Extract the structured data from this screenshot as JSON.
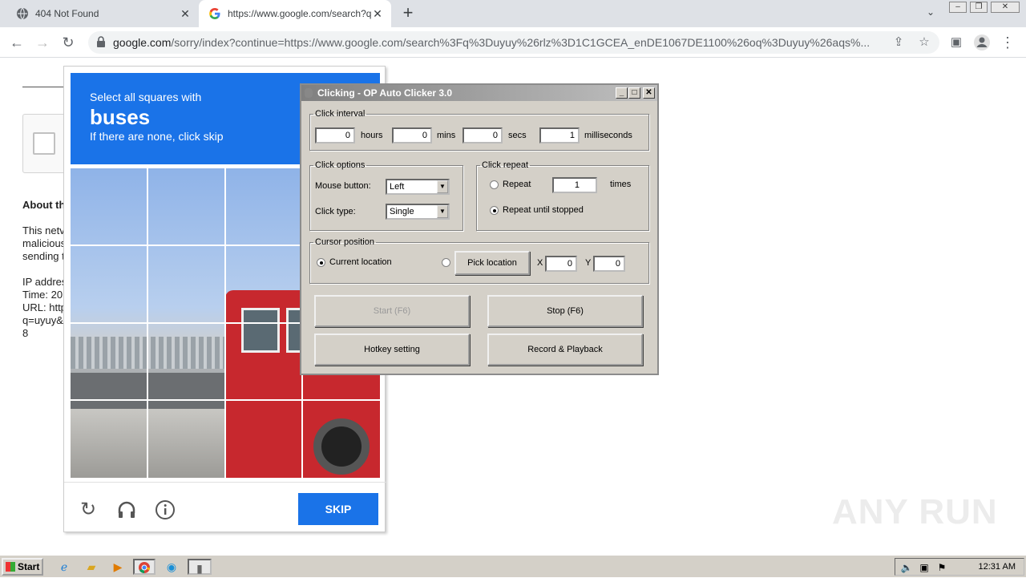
{
  "browser": {
    "tabs": [
      {
        "title": "404 Not Found",
        "icon": "globe-icon"
      },
      {
        "title": "https://www.google.com/search?q=",
        "icon": "google-icon"
      }
    ],
    "address_host": "google.com",
    "address_rest": "/sorry/index?continue=https://www.google.com/search%3Fq%3Duyuy%26rlz%3D1C1GCEA_enDE1067DE1100%26oq%3Duyuy%26aqs%..."
  },
  "page": {
    "about_heading": "About th",
    "lines": [
      "This netv",
      "malicious",
      "sending t"
    ],
    "info_lines": [
      "IP addres",
      "Time: 20",
      "URL: http",
      "q=uyuy&",
      "8"
    ]
  },
  "captcha": {
    "instruction_1": "Select all squares with",
    "target": "buses",
    "instruction_2": "If there are none, click skip",
    "skip_label": "SKIP"
  },
  "clicker": {
    "title": "Clicking - OP Auto Clicker 3.0",
    "interval_legend": "Click interval",
    "hours_value": "0",
    "hours_label": "hours",
    "mins_value": "0",
    "mins_label": "mins",
    "secs_value": "0",
    "secs_label": "secs",
    "ms_value": "1",
    "ms_label": "milliseconds",
    "options_legend": "Click options",
    "mouse_button_label": "Mouse button:",
    "mouse_button_value": "Left",
    "click_type_label": "Click type:",
    "click_type_value": "Single",
    "repeat_legend": "Click repeat",
    "repeat_label": "Repeat",
    "repeat_value": "1",
    "times_label": "times",
    "repeat_until_label": "Repeat until stopped",
    "cursor_legend": "Cursor position",
    "current_location_label": "Current location",
    "pick_location_label": "Pick location",
    "x_label": "X",
    "x_value": "0",
    "y_label": "Y",
    "y_value": "0",
    "start_label": "Start (F6)",
    "stop_label": "Stop (F6)",
    "hotkey_label": "Hotkey setting",
    "record_label": "Record & Playback"
  },
  "watermark": "ANY RUN",
  "taskbar": {
    "start_label": "Start",
    "clock": "12:31 AM"
  }
}
